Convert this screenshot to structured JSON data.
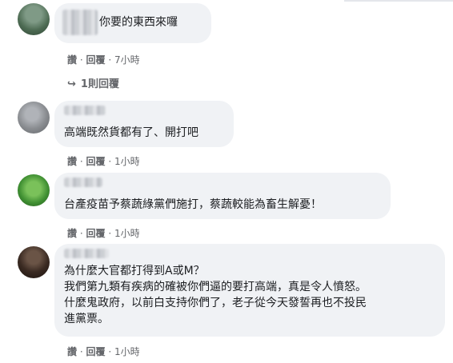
{
  "comments": [
    {
      "text_lines": [
        "你要的東西來囉"
      ],
      "actions": {
        "like": "讚",
        "reply": "回覆",
        "sep": "·",
        "time": "7小時"
      },
      "replies_label": "1則回覆",
      "avatar_color": "#4d6b53"
    },
    {
      "text_lines": [
        "高端既然貨都有了、開打吧"
      ],
      "actions": {
        "like": "讚",
        "reply": "回覆",
        "sep": "·",
        "time": "1小時"
      },
      "avatar_color": "#8a8d91"
    },
    {
      "text_lines": [
        "台產疫苗予蔡蔬綠黨們施打，蔡蔬較能為畜生解憂！"
      ],
      "actions": {
        "like": "讚",
        "reply": "回覆",
        "sep": "·",
        "time": "1小時"
      },
      "avatar_color": "#3f8f32"
    },
    {
      "text_lines": [
        "為什麼大官都打得到A或M？",
        "我們第九類有疾病的確被你們逼的要打高端，真是令人憤怒。",
        "什麼鬼政府，以前白支持你們了，老子從今天發誓再也不投民",
        "進黨票。"
      ],
      "actions": {
        "like": "讚",
        "reply": "回覆",
        "sep": "·",
        "time": "1小時"
      },
      "avatar_color": "#3a2a22"
    }
  ]
}
